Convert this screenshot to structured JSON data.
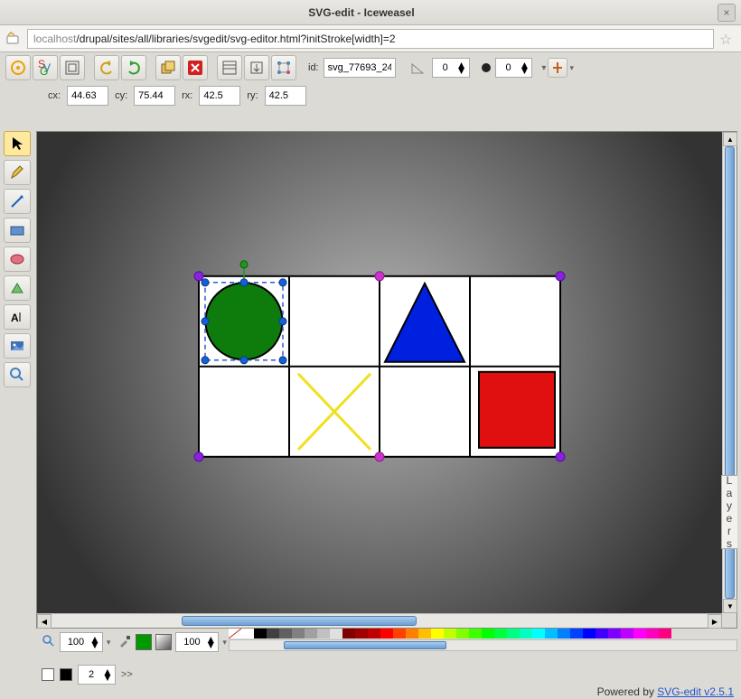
{
  "window": {
    "title": "SVG-edit - Iceweasel"
  },
  "url": {
    "host": "localhost",
    "path": "/drupal/sites/all/libraries/svgedit/svg-editor.html?initStroke[width]=2"
  },
  "toolbar": {
    "id_label": "id:",
    "id_value": "svg_77693_24",
    "angle": "0",
    "blur": "0"
  },
  "context": {
    "cx_label": "cx:",
    "cx": "44.63",
    "cy_label": "cy:",
    "cy": "75.44",
    "rx_label": "rx:",
    "rx": "42.5",
    "ry_label": "ry:",
    "ry": "42.5"
  },
  "zoom": {
    "value": "100"
  },
  "opacity": {
    "value": "100"
  },
  "stroke": {
    "width": "2",
    "dash_more": ">>"
  },
  "colors": {
    "fill": "#009900",
    "stroke": "#000000",
    "bg_swatch": "#ffffff",
    "none_swatch": "transparent"
  },
  "layers": {
    "label": "L a y e r s"
  },
  "footer": {
    "text": "Powered by ",
    "link": "SVG-edit v2.5.1"
  },
  "palette": {
    "row1": [
      "#ffffff",
      "#000000",
      "#404040",
      "#606060",
      "#808080",
      "#a0a0a0",
      "#c0c0c0",
      "#e0e0e0",
      "#800000",
      "#a00000",
      "#c00000",
      "#ff0000",
      "#ff4000",
      "#ff8000",
      "#ffc000",
      "#ffff00",
      "#c0ff00",
      "#80ff00",
      "#40ff00",
      "#00ff00",
      "#00ff40",
      "#00ff80",
      "#00ffc0",
      "#00ffff",
      "#00c0ff",
      "#0080ff",
      "#0040ff",
      "#0000ff",
      "#4000ff",
      "#8000ff",
      "#c000ff",
      "#ff00ff",
      "#ff00c0",
      "#ff0080"
    ]
  }
}
